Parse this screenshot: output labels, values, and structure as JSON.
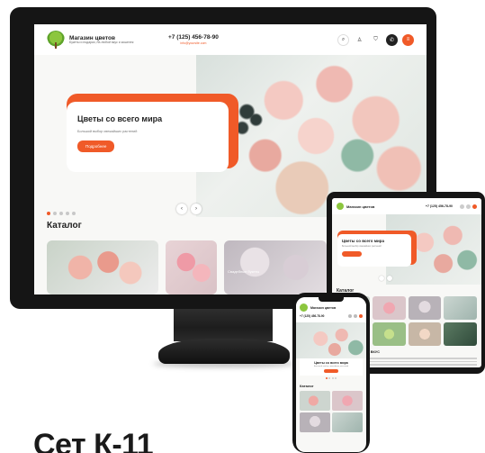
{
  "desktop": {
    "header": {
      "store_name": "Магазин цветов",
      "tagline": "Букеты и подарки, на любой вкус и кошелек",
      "phone": "+7 (125) 456-78-90",
      "email": "info@yoursite.com",
      "icons": [
        "search-icon",
        "user-icon",
        "cart-icon",
        "phone-icon",
        "menu-icon"
      ]
    },
    "hero": {
      "title": "Цветы со всего мира",
      "subtitle": "Большой выбор свежайших растений",
      "button": "Подробнее",
      "prev": "‹",
      "next": "›"
    },
    "catalog": {
      "title": "Каталог",
      "tile_label": "Свадебные букеты"
    }
  },
  "tablet": {
    "store_name": "Магазин цветов",
    "phone": "+7 (125) 456-78-90",
    "hero_title": "Цветы со всего мира",
    "hero_subtitle": "Большой выбор свежайших растений",
    "catalog_title": "Каталог",
    "text_heading": "ЦВЕТЫ НА ЛЮБОЙ ВКУС"
  },
  "phone": {
    "store_name": "Магазин цветов",
    "phone": "+7 (125) 456-78-90",
    "hero_title": "Цветы со всего мира",
    "hero_subtitle": "Большой выбор свежайших растений",
    "catalog_title": "Каталог"
  },
  "product_title": "Сет К-11",
  "colors": {
    "accent": "#f05a28",
    "brand_green": "#8cc63e",
    "device_frame": "#151515"
  }
}
